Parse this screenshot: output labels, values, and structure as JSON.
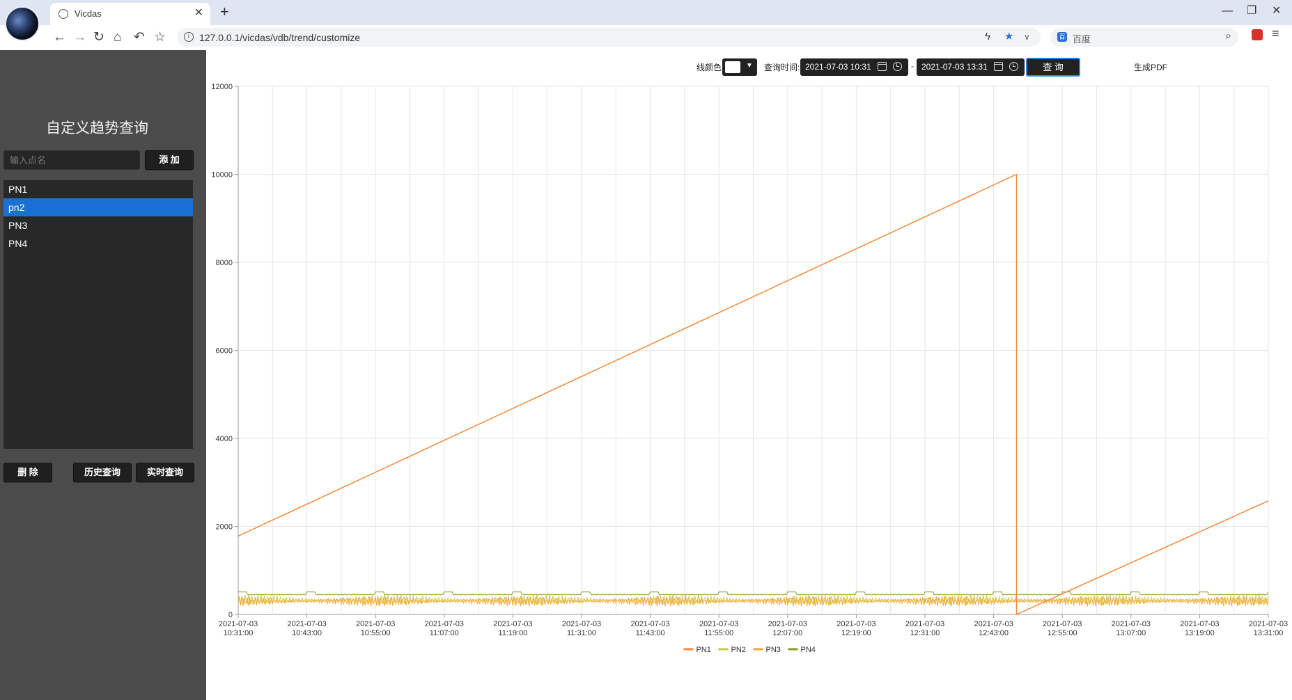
{
  "browser": {
    "tab_title": "Vicdas",
    "url": "127.0.0.1/vicdas/vdb/trend/customize",
    "search_placeholder": "百度"
  },
  "sidebar": {
    "title": "自定义趋势查询",
    "input_placeholder": "输入点名",
    "add_label": "添 加",
    "points": [
      "PN1",
      "pn2",
      "PN3",
      "PN4"
    ],
    "selected_point": "pn2",
    "delete_label": "删 除",
    "history_label": "历史查询",
    "realtime_label": "实时查询"
  },
  "toolbar": {
    "color_label": "线颜色",
    "query_time_label": "查询时间:",
    "start_time": "2021-07-03 10:31",
    "end_time": "2021-07-03 13:31",
    "separator": "-",
    "query_label": "查 询",
    "pdf_label": "生成PDF"
  },
  "colors": {
    "accent": "#1a71d3",
    "PN1": "#f28a3a",
    "PN2": "#c9cb3a",
    "PN3": "#f6a62c",
    "PN4": "#8a9a22",
    "grid": "#e6e6e6"
  },
  "chart_data": {
    "type": "line",
    "title": "",
    "xlabel": "",
    "ylabel": "",
    "ylim": [
      0,
      12000
    ],
    "yticks": [
      "0",
      "2000",
      "4000",
      "6000",
      "8000",
      "10000",
      "12000"
    ],
    "x_start": "2021-07-03 10:31:00",
    "x_end": "2021-07-03 13:31:00",
    "x_tick_labels": [
      [
        "2021-07-03",
        "10:31:00"
      ],
      [
        "2021-07-03",
        "10:43:00"
      ],
      [
        "2021-07-03",
        "10:55:00"
      ],
      [
        "2021-07-03",
        "11:07:00"
      ],
      [
        "2021-07-03",
        "11:19:00"
      ],
      [
        "2021-07-03",
        "11:31:00"
      ],
      [
        "2021-07-03",
        "11:43:00"
      ],
      [
        "2021-07-03",
        "11:55:00"
      ],
      [
        "2021-07-03",
        "12:07:00"
      ],
      [
        "2021-07-03",
        "12:19:00"
      ],
      [
        "2021-07-03",
        "12:31:00"
      ],
      [
        "2021-07-03",
        "12:43:00"
      ],
      [
        "2021-07-03",
        "12:55:00"
      ],
      [
        "2021-07-03",
        "13:07:00"
      ],
      [
        "2021-07-03",
        "13:19:00"
      ],
      [
        "2021-07-03",
        "13:31:00"
      ]
    ],
    "grid": true,
    "legend_position": "bottom",
    "series": [
      {
        "name": "PN1",
        "x": [
          "2021-07-03 10:31:00",
          "2021-07-03 12:47:00",
          "2021-07-03 12:47:00",
          "2021-07-03 13:31:00"
        ],
        "values": [
          1780,
          10000,
          0,
          2580
        ]
      },
      {
        "name": "PN2",
        "pattern": "oscillating",
        "min": 200,
        "max": 450
      },
      {
        "name": "PN3",
        "pattern": "oscillating",
        "min": 180,
        "max": 420
      },
      {
        "name": "PN4",
        "pattern": "stepped",
        "min": 380,
        "max": 510
      }
    ]
  }
}
